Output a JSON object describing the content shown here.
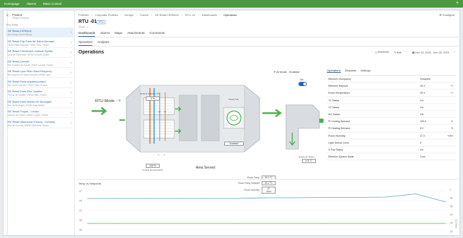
{
  "topbar": {
    "items": [
      "Homepage",
      "Alarms",
      "Mass Control"
    ],
    "add": "+"
  },
  "sidebar": {
    "back": "<",
    "location": "France",
    "location_sub": "Region Scoped",
    "section": "Key Entity",
    "items": [
      {
        "name": "SE Retail CERBUS",
        "addr": "Rue Henry Dunes Bussy"
      },
      {
        "name": "SE Retail City Paris 56 Saint-Germain",
        "addr": "75006 Saint-Germain 75006 Paris, France"
      },
      {
        "name": "SE Retail Clichensse Grande Synthe",
        "addr": "Quai de l'Ardennes, 59760 Grande Synthe"
      },
      {
        "name": "SE Retail Lomeril",
        "addr": "Rue Charles de Gaulle, 29200 Lomeril, France"
      },
      {
        "name": "SE Retail Lyon Rhin Saint Rouperry",
        "addr": "Rue Ampere de Saint-Germain, 69000 Lyon"
      },
      {
        "name": "SE Retail Paris Aqualeuconard",
        "addr": "Rue Jean Guenard, 75007 Paris, France"
      },
      {
        "name": "SE Retail Paris Rue Gauthe",
        "addr": "75 Rue de Gauthe, 75006 Paris, France"
      },
      {
        "name": "SE Retail Saint Martin De Boulogne",
        "addr": "Rue de Boulogne, 62280 Saint-Martin"
      },
      {
        "name": "SE Retail Troyes - Leclou",
        "addr": "Avenue de Leclou, 10000 Troyes, France"
      },
      {
        "name": "SE Retail Villeneuve D'Ascq - Cormisy",
        "addr": "Rue de Cormisy, 59650 Villeneuve d'Ascq"
      }
    ]
  },
  "breadcrumbs": [
    "Portfolio",
    "Corporate Portfolio",
    "Europe",
    "France",
    "SE Retail CERBUS",
    "RTU -01",
    "Dashboards",
    "Operations"
  ],
  "configure": "Configure",
  "page": {
    "title": "RTU -01",
    "badge": "RTU",
    "sub": "Serial: -1"
  },
  "tabs1": [
    "Dashboards",
    "Alarms",
    "Maps",
    "Attachments",
    "Comments"
  ],
  "tabs2": [
    "Operations",
    "Analyses"
  ],
  "panel_title": "Operations",
  "toolbar": {
    "download": "Download",
    "edit": "Edit",
    "range": "Nov 24, 2025 - Nov 25, 2025"
  },
  "diagram": {
    "rtu_mode": "RTU Mode :",
    "ai_mode": "AI Mode - Enabled",
    "on_label": "On",
    "heating_label": "Heating Setdown (%)",
    "heating_value": "0 %",
    "cooling_label": "Cooling Demand (RH)",
    "cooling_value": "100 %",
    "supply_fan_label": "Supply Fan",
    "supply_fan_state": "Enabled",
    "supply_air_label": "Supply Air Status",
    "supply_air_value": "0.0 °C",
    "area_served": "Area Served",
    "readings": [
      {
        "label": "Room Temp",
        "value": "20.3 °C"
      },
      {
        "label": "Room Temp Setpoint",
        "value": "20.4 °C"
      },
      {
        "label": "Room Humidity",
        "value": "27 %RH"
      }
    ],
    "small": [
      "10",
      "12",
      "1",
      "1"
    ]
  },
  "ops_tabs": [
    "Operations",
    "Setpoints",
    "Settings"
  ],
  "ops_rows": [
    {
      "k": "Effective Occupancy",
      "v": "Occupied",
      "u": ""
    },
    {
      "k": "Effective Setpoint",
      "v": "20.4",
      "u": "°C"
    },
    {
      "k": "Room Temperature",
      "v": "20.3",
      "u": "°C"
    },
    {
      "k": "Y1 Status",
      "v": "On",
      "u": ""
    },
    {
      "k": "Y2 Status",
      "v": "On",
      "u": ""
    },
    {
      "k": "W1 Status",
      "v": "Off",
      "u": ""
    },
    {
      "k": "PI Cooling Demand",
      "v": "100.0",
      "u": "%"
    },
    {
      "k": "PI Heating Demand",
      "v": "0.0",
      "u": "%"
    },
    {
      "k": "Room Humidity",
      "v": "27.0",
      "u": "%RH"
    },
    {
      "k": "Light Sensor Level",
      "v": "0",
      "u": ""
    },
    {
      "k": "G Fan Status",
      "v": "On",
      "u": ""
    },
    {
      "k": "Effective System Mode",
      "v": "Cool",
      "u": ""
    }
  ],
  "chart": {
    "title": "Temp vs Setpoints",
    "left_ticks": [
      "27",
      "24",
      "21",
      "18",
      "15"
    ],
    "right_ticks": [
      "1",
      "16",
      "16",
      "14",
      "15",
      "13"
    ],
    "right_axis_label": "Temp (°C)"
  },
  "chart_data": {
    "type": "line",
    "title": "Temp vs Setpoints",
    "x": [
      0,
      1,
      2,
      3,
      4,
      5,
      6,
      7,
      8,
      9,
      10,
      11,
      12
    ],
    "series": [
      {
        "values": [
          25,
          25,
          25,
          25,
          25,
          25,
          25.2,
          25.2,
          25.3,
          25.3,
          25.4,
          26.3,
          24
        ]
      },
      {
        "values": [
          17.8,
          17.8,
          17.8,
          17.8,
          17.8,
          17.8,
          17.8,
          17.8,
          17.8,
          17.8,
          17.8,
          17.8,
          17.8
        ]
      }
    ],
    "ylim": [
      15,
      28
    ],
    "colors": [
      "#5aa0c8",
      "#4caf50"
    ]
  }
}
